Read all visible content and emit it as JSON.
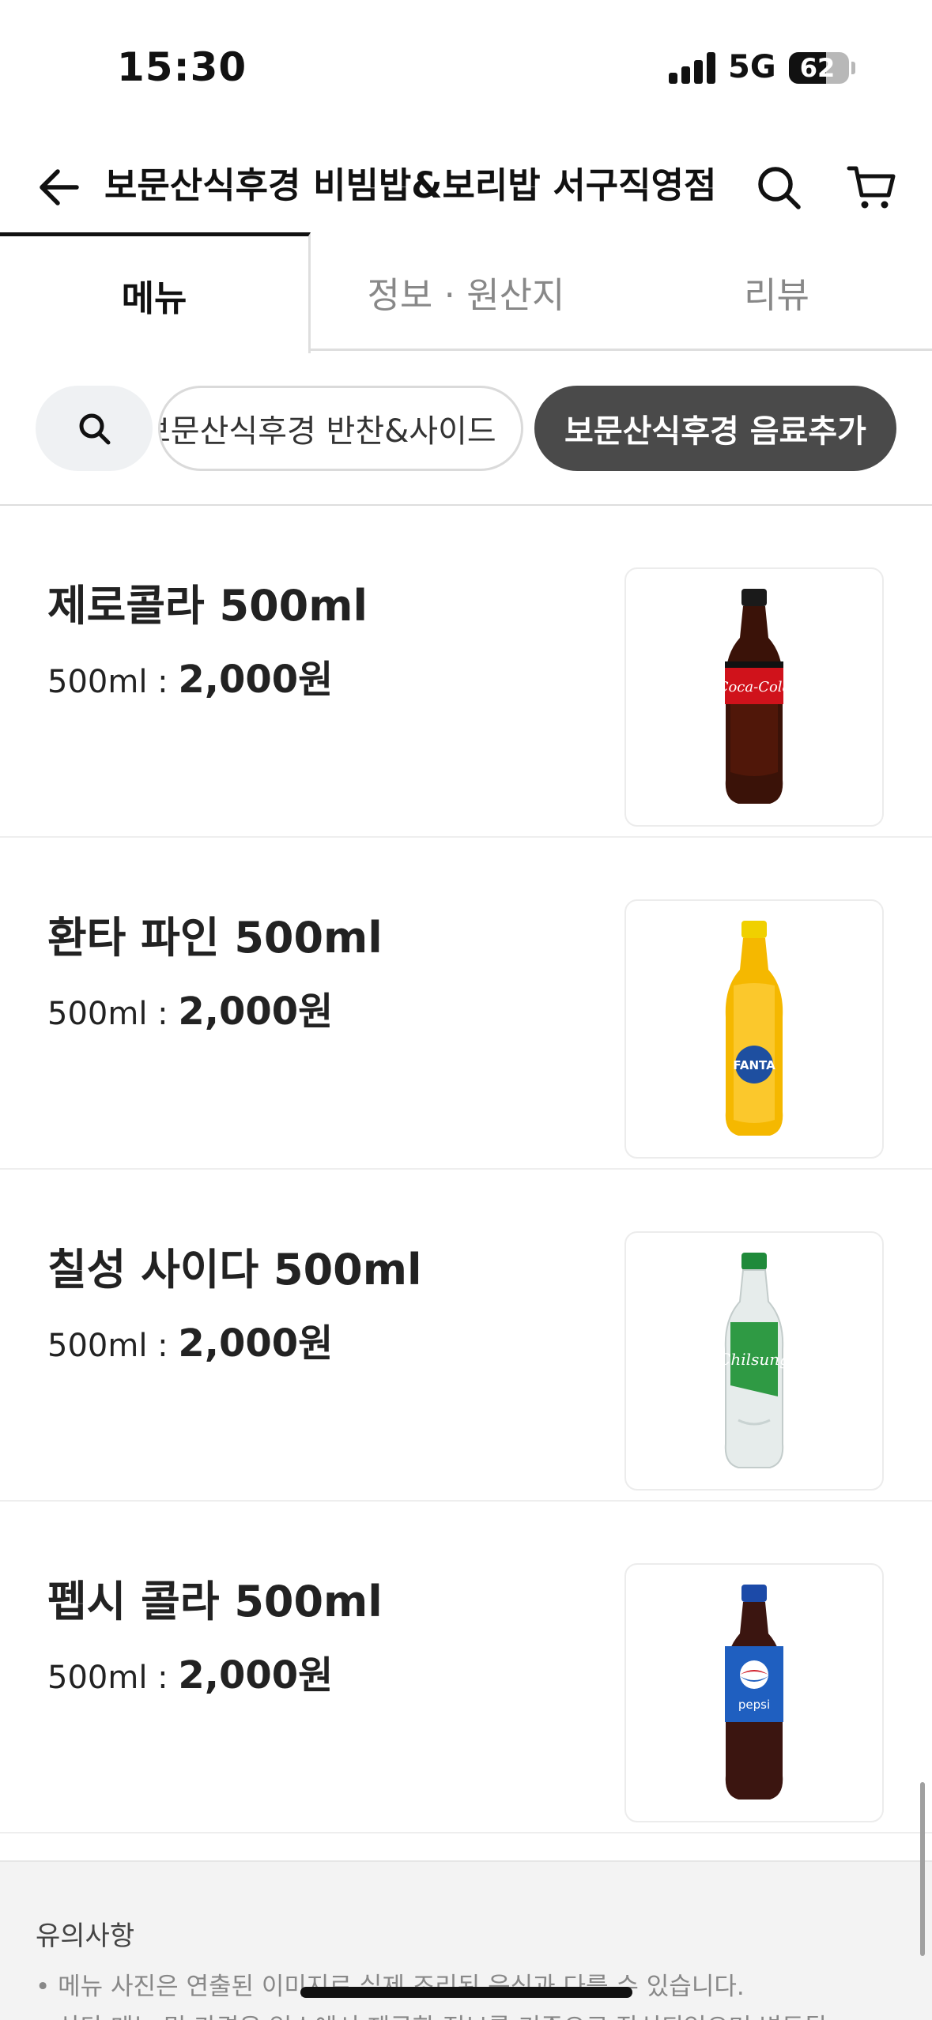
{
  "status_bar": {
    "time": "15:30",
    "network": "5G",
    "battery": "62",
    "battery_level": 0.62,
    "signal_bars": 4
  },
  "header": {
    "back_icon": "arrow-left-icon",
    "title": "보문산식후경 비빔밥&보리밥 서구직영점",
    "search_icon": "search-icon",
    "cart_icon": "cart-icon"
  },
  "tabs": [
    {
      "label": "메뉴",
      "active": true
    },
    {
      "label": "정보 · 원산지",
      "active": false
    },
    {
      "label": "리뷰",
      "active": false
    }
  ],
  "categories": {
    "search_icon": "search-icon",
    "items": [
      {
        "label": "보문산식후경 반찬&사이드",
        "active": false
      },
      {
        "label": "보문산식후경 음료추가",
        "active": true
      }
    ]
  },
  "menu_items": [
    {
      "name": "제로콜라 500ml",
      "size": "500ml : ",
      "price": "2,000원",
      "image_icon": "coca-cola-zero-bottle-icon"
    },
    {
      "name": "환타 파인 500ml",
      "size": "500ml : ",
      "price": "2,000원",
      "image_icon": "fanta-pineapple-bottle-icon"
    },
    {
      "name": "칠성 사이다 500ml",
      "size": "500ml : ",
      "price": "2,000원",
      "image_icon": "chilsung-cider-bottle-icon"
    },
    {
      "name": "펩시 콜라 500ml",
      "size": "500ml : ",
      "price": "2,000원",
      "image_icon": "pepsi-bottle-icon"
    }
  ],
  "notice": {
    "title": "유의사항",
    "lines": [
      "• 메뉴 사진은 연출된 이미지로 실제 조리된 음식과 다를 수 있습니다.",
      "• 상단 메뉴 및 가격은 업소에서 제공한 정보를 기준으로 작성되었으며 변동될"
    ]
  },
  "colors": {
    "chip_active_bg": "#4a4a4a",
    "tab_active": "#111111",
    "tab_inactive": "#888888"
  }
}
